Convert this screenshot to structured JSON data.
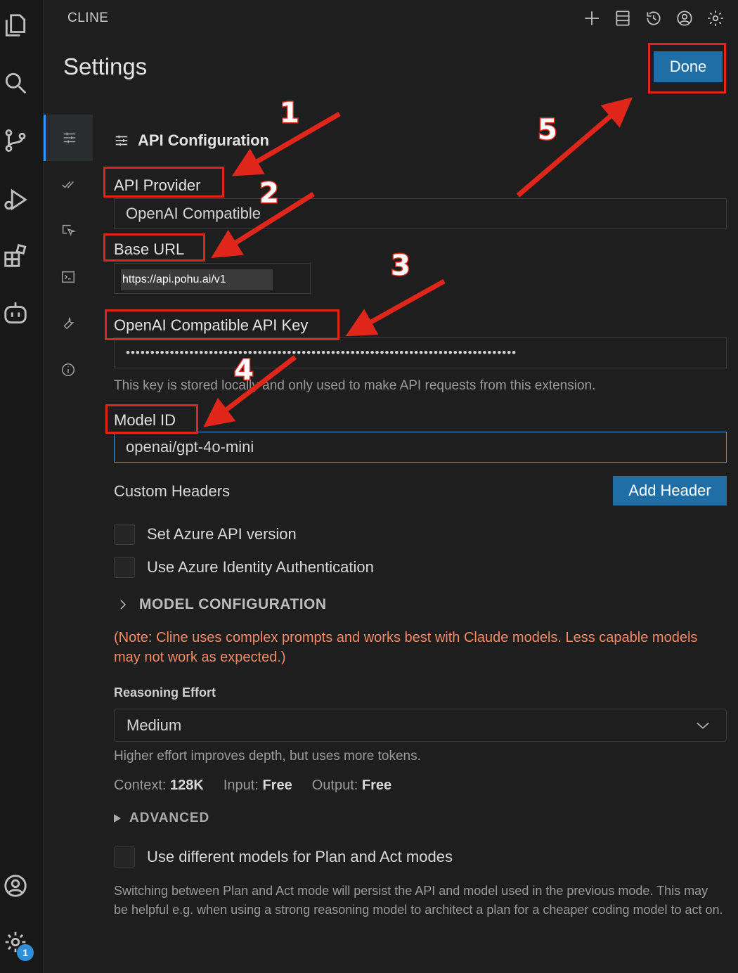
{
  "header": {
    "panel_title": "CLINE",
    "icons": [
      "plus-icon",
      "database-icon",
      "history-icon",
      "account-icon",
      "gear-icon"
    ]
  },
  "settings": {
    "title": "Settings",
    "done_label": "Done"
  },
  "side_tabs": [
    "sliders-icon",
    "check-icon",
    "cursor-icon",
    "terminal-icon",
    "wrench-icon",
    "info-icon"
  ],
  "api_config": {
    "section_title": "API Configuration",
    "provider_label": "API Provider",
    "provider_value": "OpenAI Compatible",
    "base_url_label": "Base URL",
    "base_url_value": "https://api.pohu.ai/v1",
    "api_key_label": "OpenAI Compatible API Key",
    "api_key_value": "••••••••••••••••••••••••••••••••••••••••••••••••••••••••••••••••••••••••••••••••",
    "api_key_hint": "This key is stored locally and only used to make API requests from this extension.",
    "model_id_label": "Model ID",
    "model_id_value": "openai/gpt-4o-mini"
  },
  "custom_headers": {
    "label": "Custom Headers",
    "add_label": "Add Header"
  },
  "checkboxes": {
    "azure_version": "Set Azure API version",
    "azure_identity": "Use Azure Identity Authentication",
    "plan_act": "Use different models for Plan and Act modes"
  },
  "model_config": {
    "heading": "MODEL CONFIGURATION",
    "note": "(Note: Cline uses complex prompts and works best with Claude models. Less capable models may not work as expected.)",
    "reasoning_label": "Reasoning Effort",
    "reasoning_value": "Medium",
    "reasoning_hint": "Higher effort improves depth, but uses more tokens.",
    "context_label": "Context:",
    "context_value": "128K",
    "input_label": "Input:",
    "input_value": "Free",
    "output_label": "Output:",
    "output_value": "Free"
  },
  "advanced": {
    "heading": "ADVANCED",
    "plan_act_desc": "Switching between Plan and Act mode will persist the API and model used in the previous mode. This may be helpful e.g. when using a strong reasoning model to architect a plan for a cheaper coding model to act on."
  },
  "activity_bar": {
    "icons": [
      "explorer-icon",
      "search-icon",
      "source-control-icon",
      "run-debug-icon",
      "extensions-icon",
      "cline-icon",
      "account-icon",
      "manage-icon"
    ],
    "manage_badge": "1"
  },
  "annotations": {
    "step1": "1",
    "step2": "2",
    "step3": "3",
    "step4": "4",
    "step5": "5",
    "color": "#e0261b"
  }
}
